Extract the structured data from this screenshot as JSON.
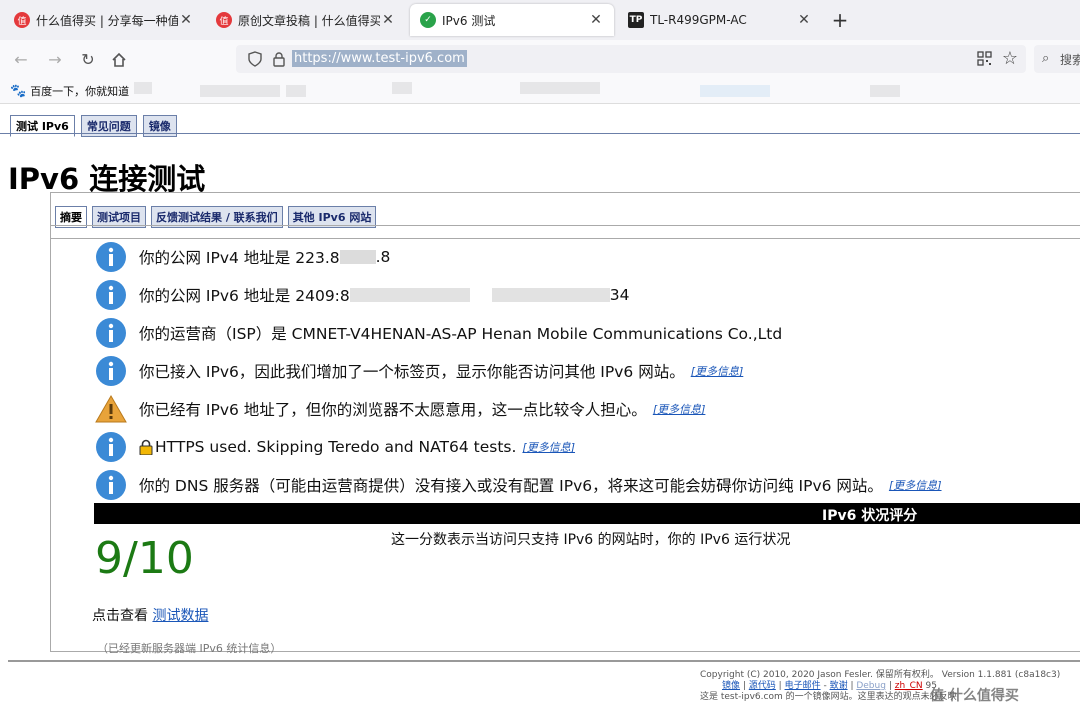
{
  "browser": {
    "tabs": [
      {
        "title": "什么值得买 | 分享每一种值",
        "favicon_text": "值",
        "favicon_color": "#e4393c"
      },
      {
        "title": "原创文章投稿 | 什么值得买",
        "favicon_text": "值",
        "favicon_color": "#e4393c"
      },
      {
        "title": "IPv6 测试",
        "favicon_color": "#2aa34a"
      },
      {
        "title": "TL-R499GPM-AC",
        "favicon_text": "TP",
        "favicon_color": "#222222"
      }
    ],
    "url": "https://www.test-ipv6.com",
    "search_placeholder": "搜索",
    "bookmark": "百度一下，你就知道"
  },
  "page": {
    "top_tabs": [
      "测试 IPv6",
      "常见问题",
      "镜像"
    ],
    "heading": "IPv6 连接测试",
    "sub_tabs": [
      "摘要",
      "测试项目",
      "反馈测试结果 / 联系我们",
      "其他 IPv6 网站"
    ],
    "results": [
      {
        "icon": "info-icon",
        "text_a": "你的公网 IPv4 地址是 223.8",
        "text_b": ".8"
      },
      {
        "icon": "info-icon",
        "text_a": "你的公网 IPv6 地址是 2409:8",
        "text_b": "34"
      },
      {
        "icon": "info-icon",
        "text": "你的运营商（ISP）是 CMNET-V4HENAN-AS-AP Henan Mobile Communications Co.,Ltd"
      },
      {
        "icon": "info-icon",
        "text": "你已接入 IPv6，因此我们增加了一个标签页，显示你能否访问其他 IPv6 网站。",
        "more": "[更多信息]"
      },
      {
        "icon": "warning-icon",
        "text": "你已经有 IPv6 地址了，但你的浏览器不太愿意用，这一点比较令人担心。",
        "more": "[更多信息]"
      },
      {
        "icon": "info-icon",
        "text": "HTTPS used. Skipping Teredo and NAT64 tests.",
        "more": "[更多信息]"
      },
      {
        "icon": "info-icon",
        "text": "你的 DNS 服务器（可能由运营商提供）没有接入或没有配置 IPv6，将来这可能会妨碍你访问纯 IPv6 网站。",
        "more": "[更多信息]"
      }
    ],
    "score_header": "IPv6 状况评分",
    "score": "9/10",
    "score_desc": "这一分数表示当访问只支持 IPv6 的网站时，你的 IPv6 运行状况",
    "view_data_prefix": "点击查看",
    "view_data_link": "测试数据",
    "stats_note": "（已经更新服务器端 IPv6 统计信息）"
  },
  "footer": {
    "copyright": "Copyright (C) 2010, 2020 Jason Fesler. 保留所有权利。 Version 1.1.881 (c8a18c3)",
    "links": [
      "镜像",
      "源代码",
      "电子邮件",
      "致谢",
      "Debug",
      "zh_CN"
    ],
    "count": "95",
    "mirror_note": "这是 test-ipv6.com 的一个镜像网站。这里表达的观点未必反映"
  },
  "watermark": "值 什么值得买",
  "colors": {
    "link": "#1a56b8",
    "score": "#1c7a14",
    "tab_border": "#6b7fa8"
  }
}
